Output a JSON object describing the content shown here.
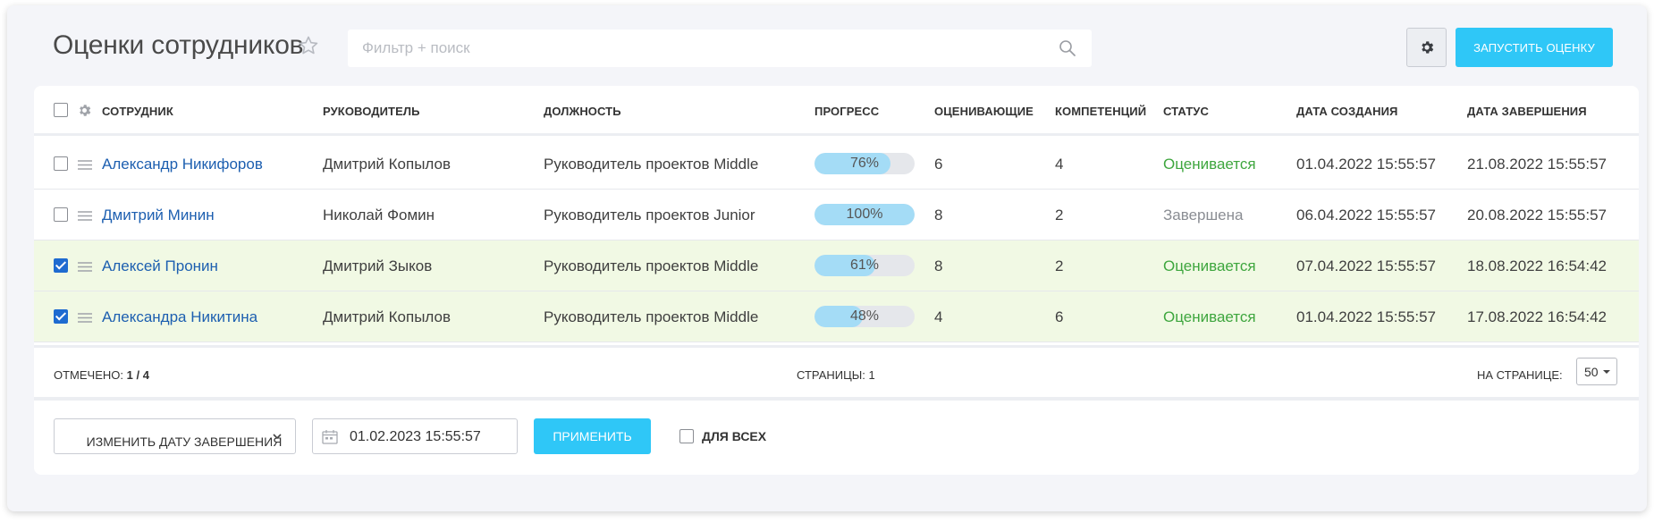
{
  "header": {
    "title": "Оценки сотрудников",
    "search_placeholder": "Фильтр + поиск",
    "launch_label": "Запустить оценку"
  },
  "table": {
    "columns": [
      "Сотрудник",
      "Руководитель",
      "Должность",
      "Прогресс",
      "Оценивающие",
      "Компетенций",
      "Статус",
      "Дата создания",
      "Дата завершения"
    ],
    "rows": [
      {
        "employee": "Александр Никифоров",
        "manager": "Дмитрий Копылов",
        "position": "Руководитель проектов Middle",
        "progress": 76,
        "progress_label": "76%",
        "raters": "6",
        "competencies": "4",
        "status": "Оценивается",
        "status_kind": "active",
        "created": "01.04.2022 15:55:57",
        "finished": "21.08.2022 15:55:57",
        "checked": false
      },
      {
        "employee": "Дмитрий Минин",
        "manager": "Николай Фомин",
        "position": "Руководитель проектов Junior",
        "progress": 100,
        "progress_label": "100%",
        "raters": "8",
        "competencies": "2",
        "status": "Завершена",
        "status_kind": "done",
        "created": "06.04.2022 15:55:57",
        "finished": "20.08.2022 15:55:57",
        "checked": false
      },
      {
        "employee": "Алексей Пронин",
        "manager": "Дмитрий Зыков",
        "position": "Руководитель проектов Middle",
        "progress": 61,
        "progress_label": "61%",
        "raters": "8",
        "competencies": "2",
        "status": "Оценивается",
        "status_kind": "active",
        "created": "07.04.2022 15:55:57",
        "finished": "18.08.2022 16:54:42",
        "checked": true
      },
      {
        "employee": "Александра Никитина",
        "manager": "Дмитрий Копылов",
        "position": "Руководитель проектов Middle",
        "progress": 48,
        "progress_label": "48%",
        "raters": "4",
        "competencies": "6",
        "status": "Оценивается",
        "status_kind": "active",
        "created": "01.04.2022 15:55:57",
        "finished": "17.08.2022 16:54:42",
        "checked": true
      }
    ]
  },
  "footer": {
    "marked_label": "Отмечено:",
    "marked_value": "1 / 4",
    "pages_label": "Страницы: 1",
    "per_page_label": "На странице:",
    "per_page_value": "50"
  },
  "actions": {
    "change_date_label": "Изменить дату завершения",
    "date_value": "01.02.2023 15:55:57",
    "apply_label": "Применить",
    "for_all_label": "Для всех"
  },
  "colors": {
    "accent": "#2fc7f7",
    "link": "#1d5fb0",
    "status_active": "#3ea63e",
    "status_done": "#8a8d93",
    "selected_row": "#f1f9e4",
    "progress_fill": "#a4dcf6"
  },
  "icons": [
    "star-icon",
    "search-icon",
    "gear-icon",
    "drag-handle-icon",
    "calendar-icon",
    "chevron-down-icon"
  ]
}
